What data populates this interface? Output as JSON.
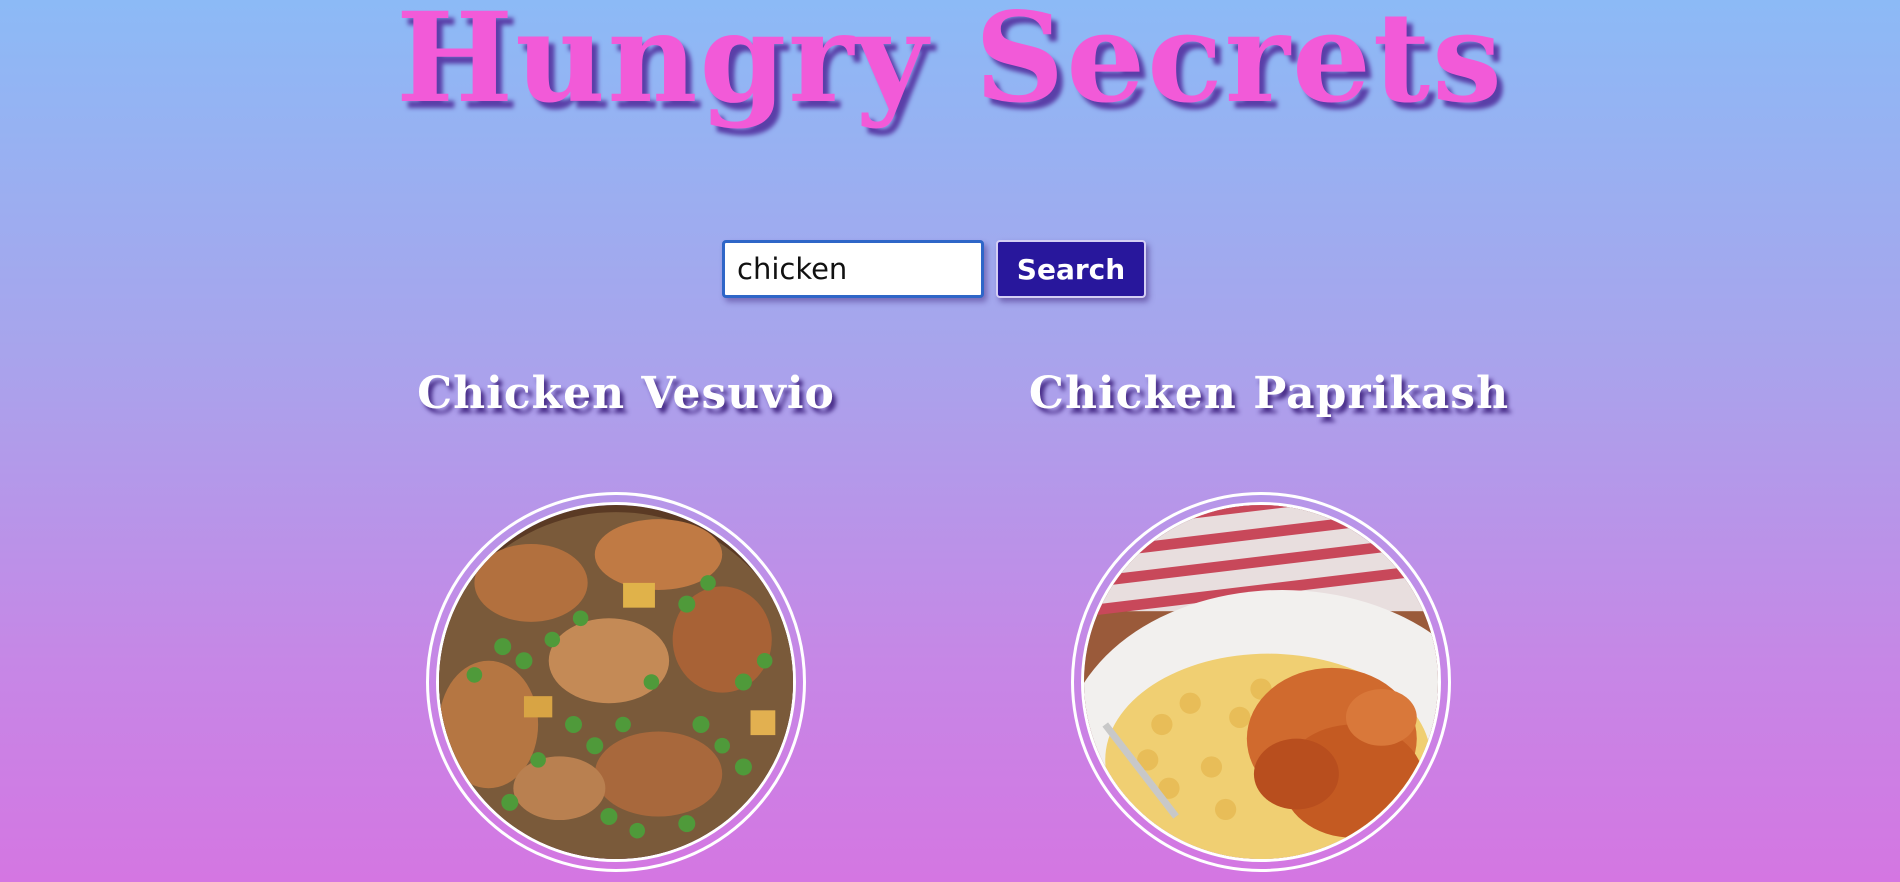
{
  "header": {
    "title": "Hungry Secrets"
  },
  "search": {
    "value": "chicken",
    "button_label": "Search"
  },
  "recipes": [
    {
      "title": "Chicken Vesuvio",
      "image": "chicken-vesuvio-photo"
    },
    {
      "title": "Chicken Paprikash",
      "image": "chicken-paprikash-photo"
    }
  ],
  "colors": {
    "title": "#f25ad8",
    "button": "#28179c",
    "gradient_top": "#8cbaf6",
    "gradient_bottom": "#d476e2"
  }
}
